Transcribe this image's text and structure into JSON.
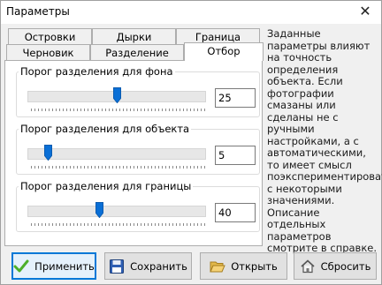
{
  "window": {
    "title": "Параметры",
    "close_glyph": "✕"
  },
  "tabs": {
    "row_back": [
      {
        "label": "Островки"
      },
      {
        "label": "Дырки"
      },
      {
        "label": "Граница"
      }
    ],
    "row_front": [
      {
        "label": "Черновик"
      },
      {
        "label": "Разделение"
      },
      {
        "label": "Отбор"
      }
    ],
    "active": "Отбор"
  },
  "groups": [
    {
      "label": "Порог разделения для фона",
      "value": "25",
      "level_fraction": 0.5
    },
    {
      "label": "Порог разделения для объекта",
      "value": "5",
      "level_fraction": 0.1
    },
    {
      "label": "Порог разделения для границы",
      "value": "40",
      "level_fraction": 0.4
    }
  ],
  "help_text": "Заданные параметры влияют на точность определения объекта. Если фотографии смазаны или сделаны не с ручными настройками, а с автоматическими, то имеет смысл поэкспериментировать с некоторыми значениями. Описание отдельных параметров смотрите в справке.",
  "buttons": [
    {
      "label": "Применить",
      "icon": "checkmark-icon"
    },
    {
      "label": "Сохранить",
      "icon": "floppy-disk-icon"
    },
    {
      "label": "Открыть",
      "icon": "folder-open-icon"
    },
    {
      "label": "Сбросить",
      "icon": "home-icon"
    }
  ],
  "colors": {
    "accent": "#0078d7",
    "thumb": "#0a6fd6",
    "check": "#4caf2a"
  }
}
